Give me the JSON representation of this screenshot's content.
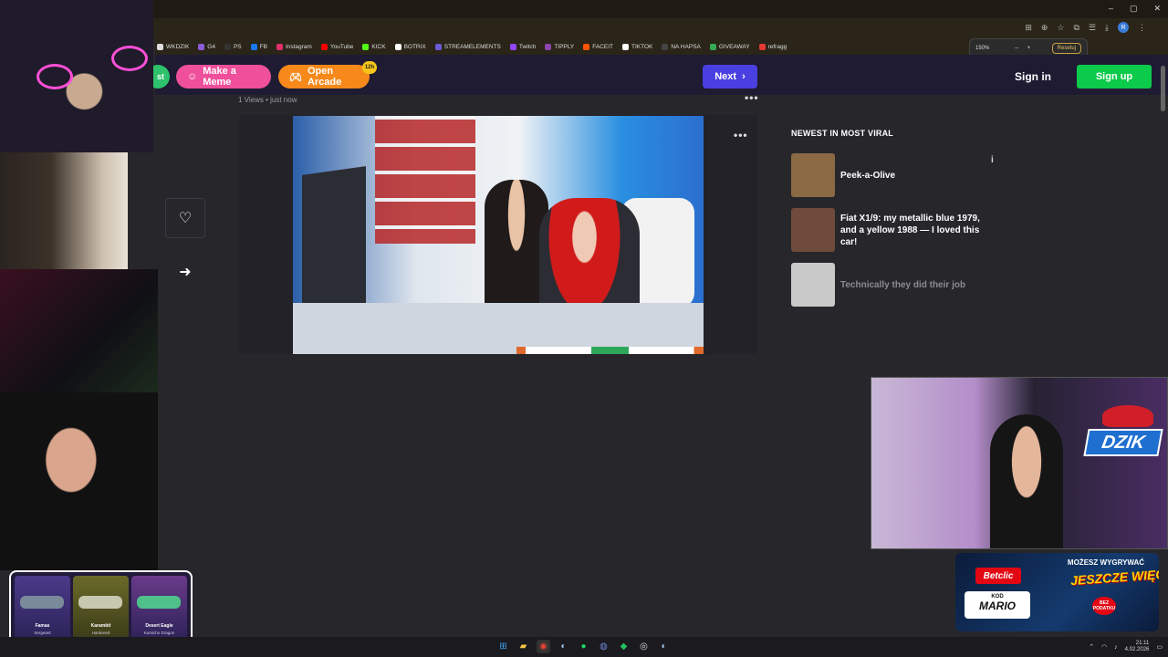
{
  "browser": {
    "window_controls": {
      "minimize": "–",
      "maximize": "▢",
      "close": "✕"
    },
    "zoom": {
      "level": "150%",
      "minus": "–",
      "plus": "+",
      "reset_label": "Resetuj"
    },
    "profile_initial": "R",
    "bookmarks": [
      {
        "label": "WKDZIK",
        "color": "#dddddd"
      },
      {
        "label": "G4",
        "color": "#8c5bd6"
      },
      {
        "label": "PS",
        "color": "#333333"
      },
      {
        "label": "FB",
        "color": "#1877f2"
      },
      {
        "label": "Instagram",
        "color": "#e1306c"
      },
      {
        "label": "YouTube",
        "color": "#ff0000"
      },
      {
        "label": "KICK",
        "color": "#53fc18"
      },
      {
        "label": "BOTRIX",
        "color": "#ffffff"
      },
      {
        "label": "STREAMELEMENTS",
        "color": "#6b5bd6"
      },
      {
        "label": "Twitch",
        "color": "#9146ff"
      },
      {
        "label": "TIPPLY",
        "color": "#8e44ad"
      },
      {
        "label": "FACEIT",
        "color": "#ff5500"
      },
      {
        "label": "TIKTOK",
        "color": "#ffffff"
      },
      {
        "label": "NA HAPSA",
        "color": "#444444"
      },
      {
        "label": "GIVEAWAY",
        "color": "#34a853"
      },
      {
        "label": "refragg",
        "color": "#e53935"
      }
    ]
  },
  "header": {
    "partial_button": "st",
    "make_meme": "Make a Meme",
    "open_arcade": "Open Arcade",
    "arcade_badge": "12h",
    "next": "Next",
    "sign_in": "Sign in",
    "sign_up": "Sign up"
  },
  "post": {
    "views": "1 Views",
    "time": "just now",
    "more": "•••"
  },
  "sidebar": {
    "title": "NEWEST IN MOST VIRAL",
    "items": [
      {
        "title": "Peek-a-Olive",
        "thumb_color": "#8a6a45"
      },
      {
        "title": "Fiat X1/9: my metallic blue 1979, and a yellow 1988 — I loved this car!",
        "thumb_color": "#6e4b3a"
      },
      {
        "title": "Technically they did their job",
        "thumb_color": "#c9c9c9"
      }
    ]
  },
  "overlay": {
    "dzik_logo": "DZIK",
    "ad": {
      "headline": "MOŻESZ WYGRYWAĆ",
      "big": "JESZCZE WIĘCEJ",
      "brand": "Betclic",
      "code_label": "KOD",
      "code": "MARIO",
      "stamp": "BEZ PODATKU"
    },
    "cards": [
      {
        "name": "Famas",
        "skin": "Sergeant"
      },
      {
        "name": "Karambit",
        "skin": "Hardened"
      },
      {
        "name": "Desert Eagle",
        "skin": "Kumicho Dragon"
      }
    ]
  },
  "taskbar": {
    "time": "21:11",
    "date": "4.02.2026"
  }
}
